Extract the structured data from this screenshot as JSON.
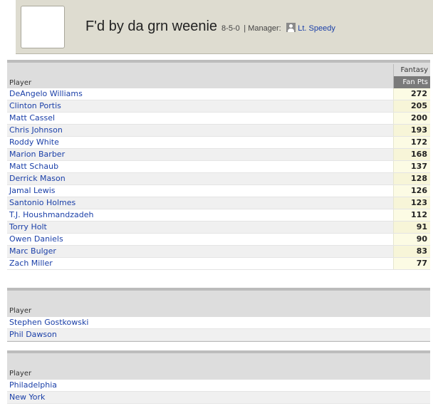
{
  "team": {
    "name": "F'd by da grn weenie",
    "record": "8-5-0",
    "manager_label": "| Manager:",
    "manager_name": "Lt. Speedy"
  },
  "starters": {
    "player_header": "Player",
    "group_header": "Fantasy",
    "points_header": "Fan Pts",
    "rows": [
      {
        "player": "DeAngelo Williams",
        "pts": "272"
      },
      {
        "player": "Clinton Portis",
        "pts": "205"
      },
      {
        "player": "Matt Cassel",
        "pts": "200"
      },
      {
        "player": "Chris Johnson",
        "pts": "193"
      },
      {
        "player": "Roddy White",
        "pts": "172"
      },
      {
        "player": "Marion Barber",
        "pts": "168"
      },
      {
        "player": "Matt Schaub",
        "pts": "137"
      },
      {
        "player": "Derrick Mason",
        "pts": "128"
      },
      {
        "player": "Jamal Lewis",
        "pts": "126"
      },
      {
        "player": "Santonio Holmes",
        "pts": "123"
      },
      {
        "player": "T.J. Houshmandzadeh",
        "pts": "112"
      },
      {
        "player": "Torry Holt",
        "pts": "91"
      },
      {
        "player": "Owen Daniels",
        "pts": "90"
      },
      {
        "player": "Marc Bulger",
        "pts": "83"
      },
      {
        "player": "Zach Miller",
        "pts": "77"
      }
    ]
  },
  "kickers": {
    "player_header": "Player",
    "rows": [
      {
        "player": "Stephen Gostkowski"
      },
      {
        "player": "Phil Dawson"
      }
    ]
  },
  "defenses": {
    "player_header": "Player",
    "rows": [
      {
        "player": "Philadelphia"
      },
      {
        "player": "New York"
      }
    ]
  }
}
